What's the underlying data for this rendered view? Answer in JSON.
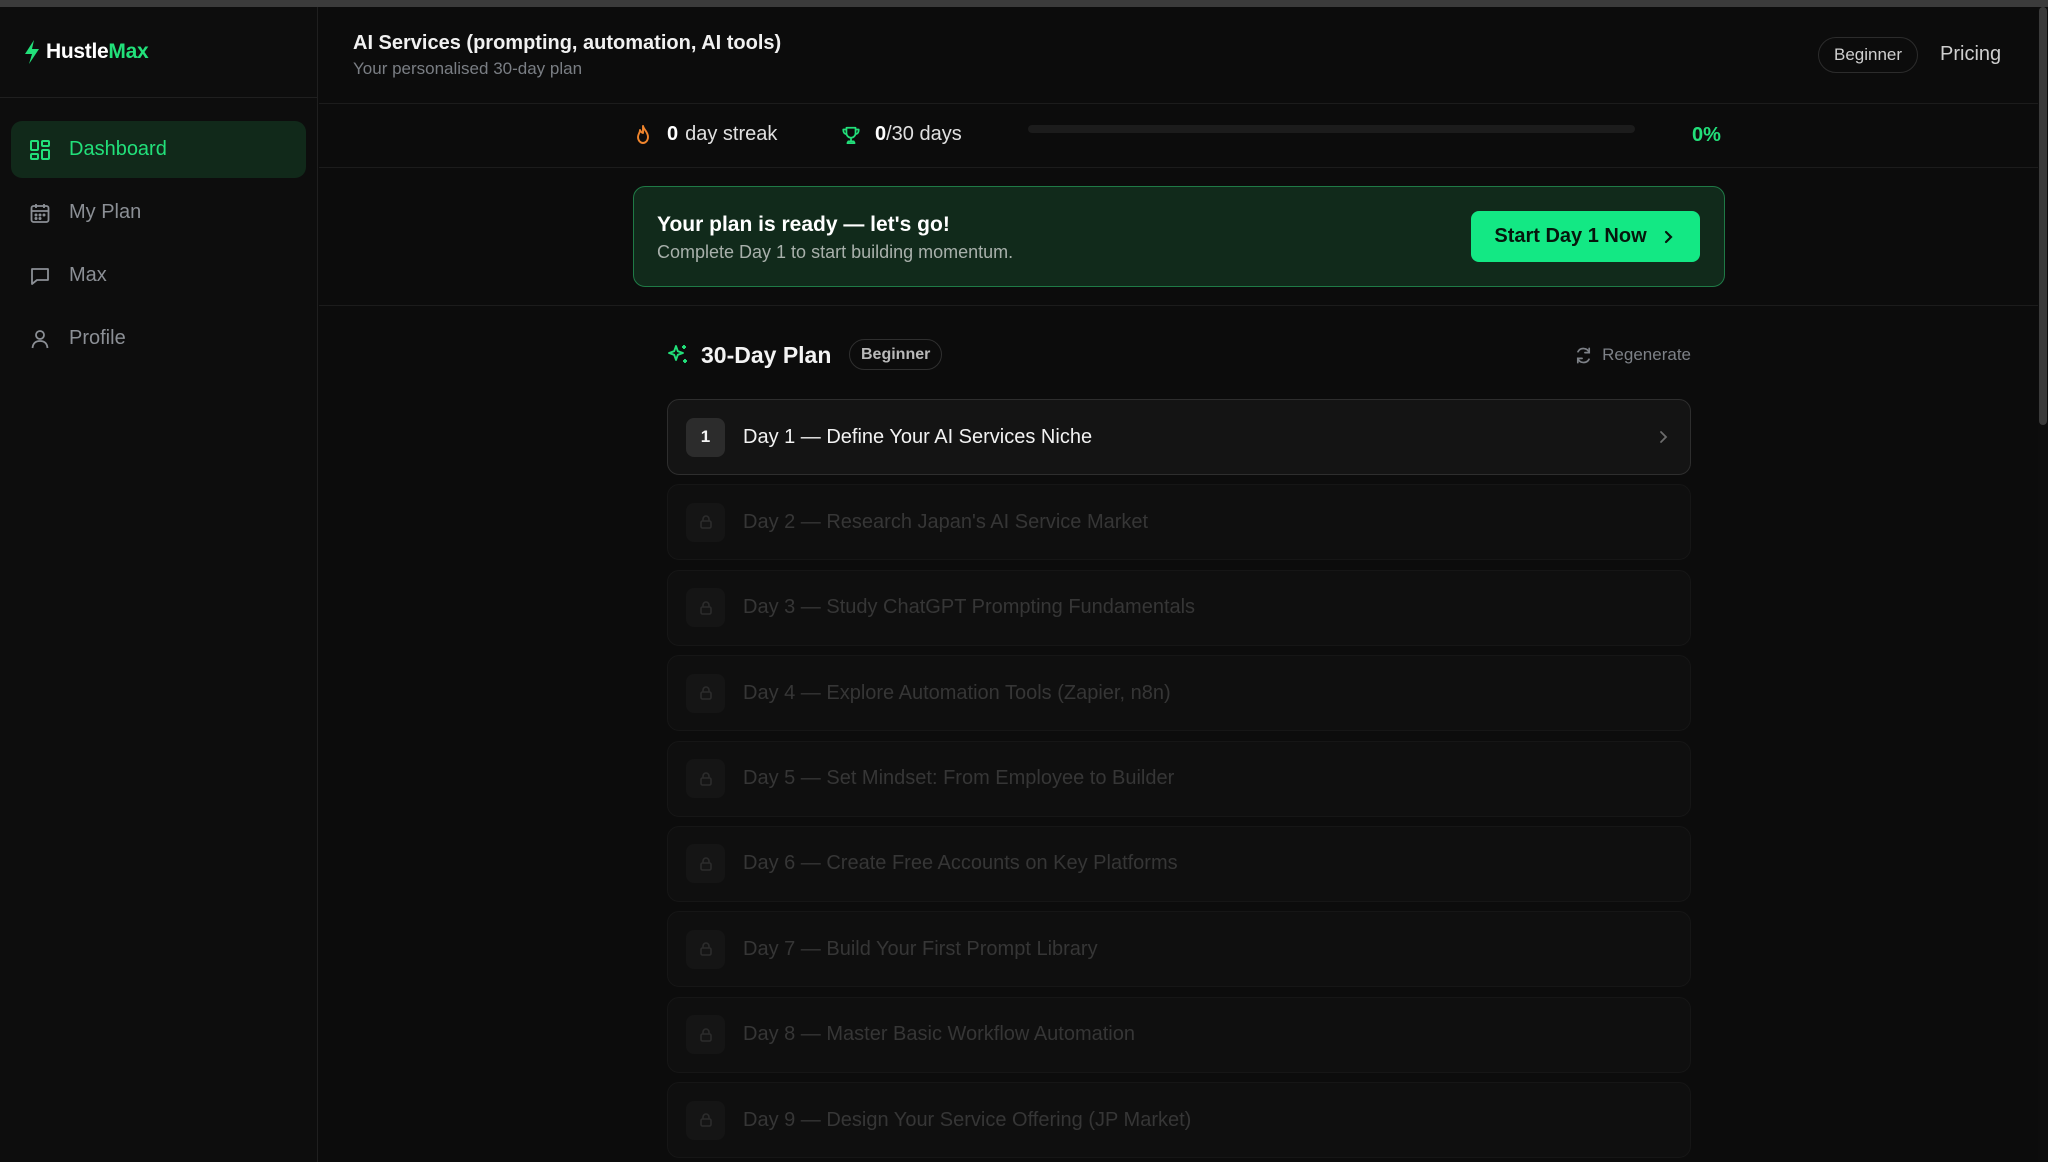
{
  "brand": {
    "name_a": "Hustle",
    "name_b": "Max",
    "accent": "#22e07a"
  },
  "sidebar": {
    "items": [
      {
        "label": "Dashboard",
        "icon": "dashboard-icon",
        "active": true
      },
      {
        "label": "My Plan",
        "icon": "calendar-icon",
        "active": false
      },
      {
        "label": "Max",
        "icon": "chat-icon",
        "active": false
      },
      {
        "label": "Profile",
        "icon": "user-icon",
        "active": false
      }
    ]
  },
  "header": {
    "title": "AI Services (prompting, automation, AI tools)",
    "subtitle": "Your personalised 30-day plan",
    "level": "Beginner",
    "pricing": "Pricing"
  },
  "stats": {
    "streak_value": "0",
    "streak_label": "day streak",
    "days_value": "0",
    "days_label": "/30 days",
    "progress_percent": 0,
    "progress_label": "0%"
  },
  "banner": {
    "title": "Your plan is ready — let's go!",
    "subtitle": "Complete Day 1 to start building momentum.",
    "cta": "Start Day 1 Now"
  },
  "plan": {
    "title": "30-Day Plan",
    "level": "Beginner",
    "regenerate": "Regenerate",
    "days": [
      {
        "num": "1",
        "label": "Day 1 — Define Your AI Services Niche",
        "locked": false
      },
      {
        "num": "2",
        "label": "Day 2 — Research Japan's AI Service Market",
        "locked": true
      },
      {
        "num": "3",
        "label": "Day 3 — Study ChatGPT Prompting Fundamentals",
        "locked": true
      },
      {
        "num": "4",
        "label": "Day 4 — Explore Automation Tools (Zapier, n8n)",
        "locked": true
      },
      {
        "num": "5",
        "label": "Day 5 — Set Mindset: From Employee to Builder",
        "locked": true
      },
      {
        "num": "6",
        "label": "Day 6 — Create Free Accounts on Key Platforms",
        "locked": true
      },
      {
        "num": "7",
        "label": "Day 7 — Build Your First Prompt Library",
        "locked": true
      },
      {
        "num": "8",
        "label": "Day 8 — Master Basic Workflow Automation",
        "locked": true
      },
      {
        "num": "9",
        "label": "Day 9 — Design Your Service Offering (JP Market)",
        "locked": true
      }
    ]
  }
}
